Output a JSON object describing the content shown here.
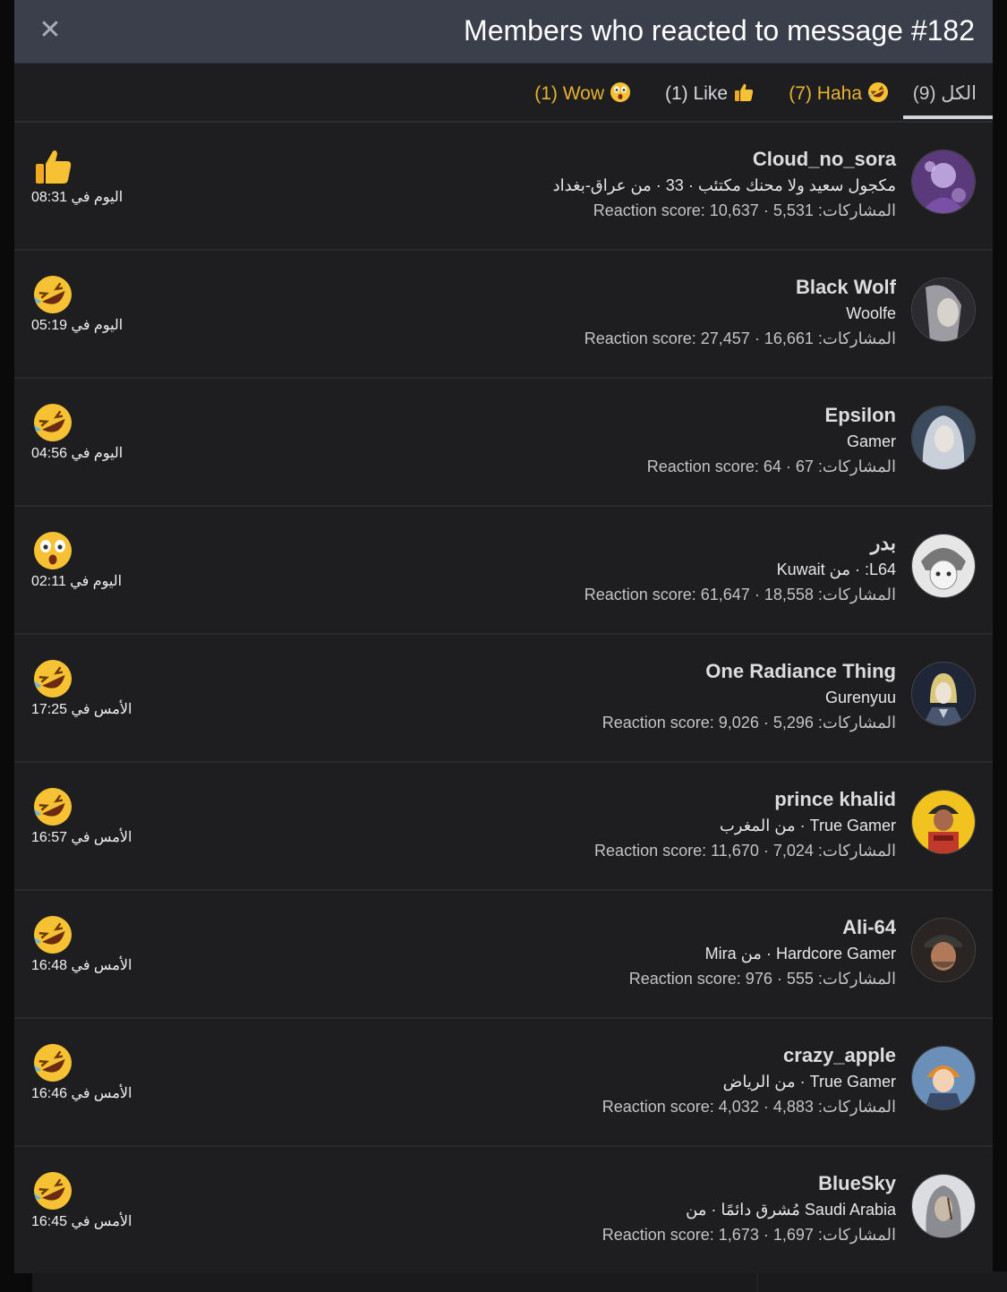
{
  "header": {
    "title": "Members who reacted to message #182",
    "close_icon": "close-icon"
  },
  "tabs": [
    {
      "label": "الكل (9)",
      "active": true
    },
    {
      "label": "(7) Haha",
      "emoji": "haha"
    },
    {
      "label": "(1) Like",
      "emoji": "like"
    },
    {
      "label": "(1) Wow",
      "emoji": "wow"
    }
  ],
  "colors": {
    "header_bg": "#3a3f4b",
    "modal_bg": "#1e1e20",
    "tab_accent": "#e8b12e",
    "tab_underline": "#cfd3da"
  },
  "members": [
    {
      "name": "Cloud_no_sora",
      "title": "مكجول سعيد ولا محنك مكتئب · 33 · من عراق-بغداد",
      "stats": "Reaction score: 10,637 · 5,531 :المشاركات",
      "reaction": "like",
      "time": "اليوم في 08:31",
      "avatar": "avatar-cloud"
    },
    {
      "name": "Black Wolf",
      "title": "Woolfe",
      "stats": "Reaction score: 27,457 · 16,661 :المشاركات",
      "reaction": "haha",
      "time": "اليوم في 05:19",
      "avatar": "avatar-blackwolf"
    },
    {
      "name": "Epsilon",
      "title": "Gamer",
      "stats": "Reaction score: 64 · 67 :المشاركات",
      "reaction": "haha",
      "time": "اليوم في 04:56",
      "avatar": "avatar-epsilon"
    },
    {
      "name": "بدر",
      "title": "Kuwait من · :L64",
      "stats": "Reaction score: 61,647 · 18,558 :المشاركات",
      "reaction": "wow",
      "time": "اليوم في 02:11",
      "avatar": "avatar-badr"
    },
    {
      "name": "One Radiance Thing",
      "title": "Gurenyuu",
      "stats": "Reaction score: 9,026 · 5,296 :المشاركات",
      "reaction": "haha",
      "time": "الأمس في 17:25",
      "avatar": "avatar-radiance"
    },
    {
      "name": "prince khalid",
      "title": "من المغرب · True Gamer",
      "stats": "Reaction score: 11,670 · 7,024 :المشاركات",
      "reaction": "haha",
      "time": "الأمس في 16:57",
      "avatar": "avatar-khalid"
    },
    {
      "name": "Ali-64",
      "title": "Mira من · Hardcore Gamer",
      "stats": "Reaction score: 976 · 555 :المشاركات",
      "reaction": "haha",
      "time": "الأمس في 16:48",
      "avatar": "avatar-ali"
    },
    {
      "name": "crazy_apple",
      "title": "من الرياض · True Gamer",
      "stats": "Reaction score: 4,032 · 4,883 :المشاركات",
      "reaction": "haha",
      "time": "الأمس في 16:46",
      "avatar": "avatar-apple"
    },
    {
      "name": "BlueSky",
      "title": "مُشرق دائمًا · من Saudi Arabia",
      "stats": "Reaction score: 1,673 · 1,697 :المشاركات",
      "reaction": "haha",
      "time": "الأمس في 16:45",
      "avatar": "avatar-bluesky"
    }
  ]
}
